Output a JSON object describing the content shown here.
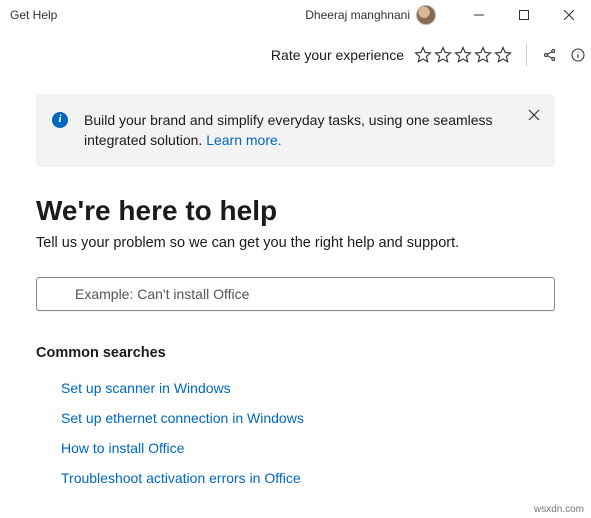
{
  "window": {
    "app_title": "Get Help",
    "user_name": "Dheeraj manghnani"
  },
  "toolbar": {
    "rate_label": "Rate your experience"
  },
  "banner": {
    "text_before": "Build your brand and simplify everyday tasks, using one seamless integrated solution. ",
    "link_text": "Learn more."
  },
  "headline": "We're here to help",
  "subhead": "Tell us your problem so we can get you the right help and support.",
  "search": {
    "placeholder": "Example: Can't install Office"
  },
  "common": {
    "title": "Common searches",
    "items": [
      {
        "label": "Set up scanner in Windows"
      },
      {
        "label": "Set up ethernet connection in Windows"
      },
      {
        "label": "How to install Office"
      },
      {
        "label": "Troubleshoot activation errors in Office"
      }
    ]
  },
  "watermark": "wsxdn.com"
}
